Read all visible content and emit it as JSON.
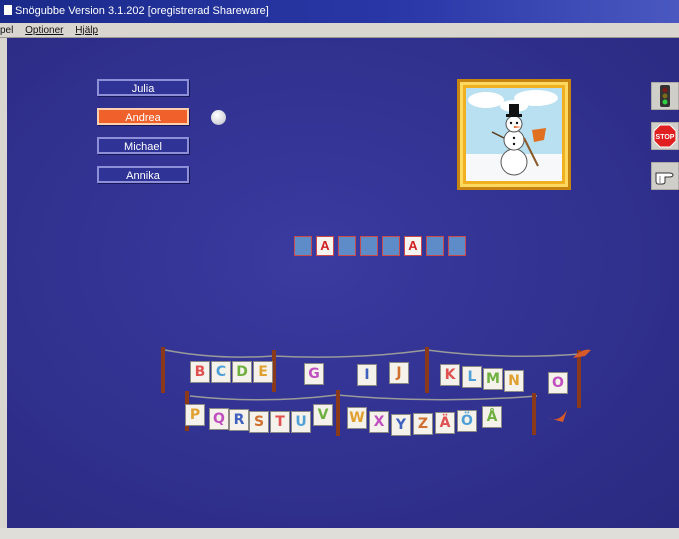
{
  "window": {
    "title": "Snögubbe  Version 3.1.202  [oregistrerad Shareware]",
    "menu": [
      "pel",
      "Optioner",
      "Hjälp"
    ]
  },
  "players": [
    {
      "name": "Julia",
      "active": false
    },
    {
      "name": "Andrea",
      "active": true
    },
    {
      "name": "Michael",
      "active": false
    },
    {
      "name": "Annika",
      "active": false
    }
  ],
  "picture": {
    "subject": "snowman"
  },
  "side_buttons": [
    {
      "icon": "traffic-light-icon"
    },
    {
      "icon": "stop-sign-icon",
      "label": "STOP"
    },
    {
      "icon": "pointing-hand-icon"
    }
  ],
  "word": {
    "tiles": [
      "",
      "A",
      "",
      "",
      "",
      "A",
      "",
      ""
    ]
  },
  "alphabet": {
    "row1": [
      "B",
      "C",
      "D",
      "E",
      "G",
      "I",
      "J",
      "K",
      "L",
      "M",
      "N",
      "O"
    ],
    "row2": [
      "P",
      "Q",
      "R",
      "S",
      "T",
      "U",
      "V",
      "W",
      "X",
      "Y",
      "Z",
      "Ä",
      "Ö",
      "Å"
    ]
  },
  "colors": {
    "background": "#30308e",
    "active_player": "#f0602a",
    "frame": "#f0b020"
  }
}
